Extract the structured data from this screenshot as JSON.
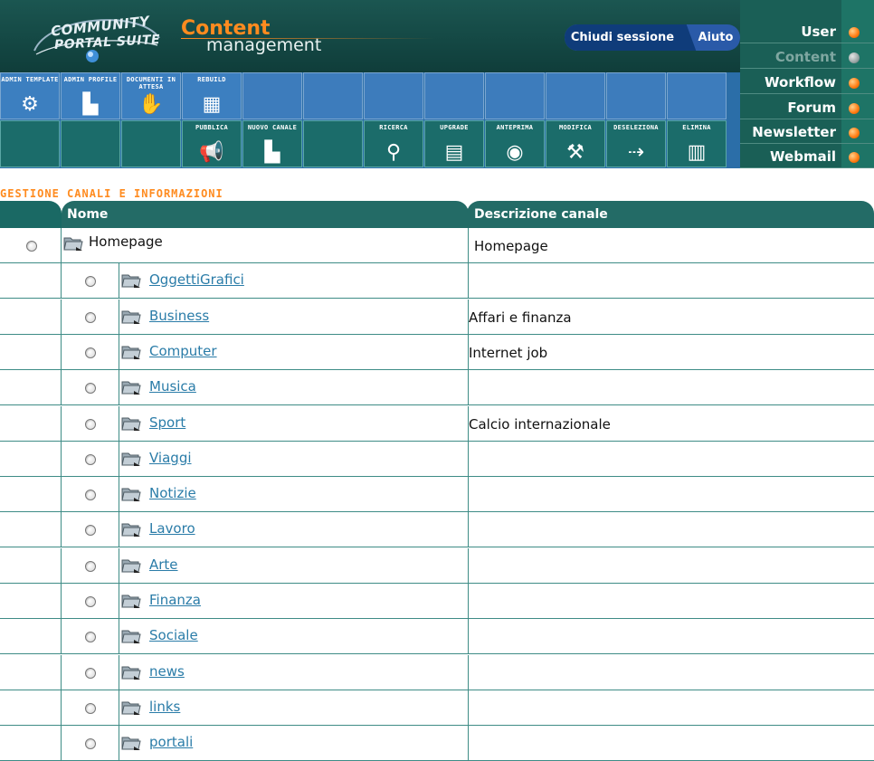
{
  "brand": {
    "logo_line1": "COMMUNITY",
    "logo_line2": "PORTAL SUITE",
    "product_title": "Content",
    "product_subtitle": "management"
  },
  "session": {
    "logout_label": "Chiudi sessione",
    "help_label": "Aiuto"
  },
  "right_menu": [
    {
      "label": "User",
      "active": true
    },
    {
      "label": "Content",
      "active": false
    },
    {
      "label": "Workflow",
      "active": true
    },
    {
      "label": "Forum",
      "active": true
    },
    {
      "label": "Newsletter",
      "active": true
    },
    {
      "label": "Webmail",
      "active": true
    }
  ],
  "toolbar": {
    "row1": [
      {
        "label": "ADMIN TEMPLATE",
        "icon": "gears-icon"
      },
      {
        "label": "ADMIN PROFILE",
        "icon": "folder-icon"
      },
      {
        "label": "DOCUMENTI IN ATTESA",
        "icon": "hand-icon"
      },
      {
        "label": "REBUILD",
        "icon": "bricks-icon"
      }
    ],
    "row2": [
      {
        "label": "PUBBLICA",
        "icon": "megaphone-icon"
      },
      {
        "label": "NUOVO CANALE",
        "icon": "new-folder-icon"
      },
      {
        "label": "RICERCA",
        "icon": "magnifier-icon"
      },
      {
        "label": "UPGRADE",
        "icon": "upgrade-icon"
      },
      {
        "label": "ANTEPRIMA",
        "icon": "eye-icon"
      },
      {
        "label": "MODIFICA",
        "icon": "tools-icon"
      },
      {
        "label": "DESELEZIONA",
        "icon": "deselect-icon"
      },
      {
        "label": "ELIMINA",
        "icon": "trash-icon"
      }
    ]
  },
  "page": {
    "section_title": "GESTIONE CANALI E INFORMAZIONI"
  },
  "table": {
    "headers": {
      "name": "Nome",
      "description": "Descrizione canale"
    },
    "root": {
      "name": "Homepage",
      "description": "Homepage"
    },
    "rows": [
      {
        "name": "OggettiGrafici",
        "description": ""
      },
      {
        "name": "Business",
        "description": "Affari e finanza"
      },
      {
        "name": "Computer",
        "description": "Internet job"
      },
      {
        "name": "Musica",
        "description": ""
      },
      {
        "name": "Sport",
        "description": "Calcio internazionale"
      },
      {
        "name": "Viaggi",
        "description": ""
      },
      {
        "name": "Notizie",
        "description": ""
      },
      {
        "name": "Lavoro",
        "description": ""
      },
      {
        "name": "Arte",
        "description": ""
      },
      {
        "name": "Finanza",
        "description": ""
      },
      {
        "name": "Sociale",
        "description": ""
      },
      {
        "name": "news",
        "description": ""
      },
      {
        "name": "links",
        "description": ""
      },
      {
        "name": "portali",
        "description": ""
      }
    ]
  },
  "colors": {
    "header_teal": "#1f5a55",
    "toolbar_blue": "#3c7fc0",
    "accent_orange": "#ff8b1f",
    "link_blue": "#2a7ca8"
  }
}
